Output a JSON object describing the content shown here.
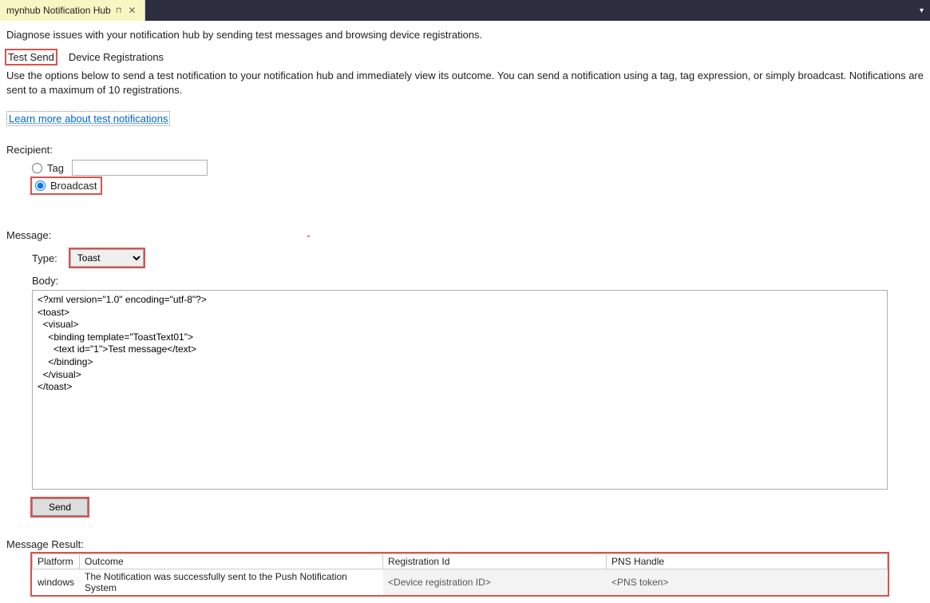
{
  "tab": {
    "title": "mynhub Notification Hub"
  },
  "intro": "Diagnose issues with your notification hub by sending test messages and browsing device registrations.",
  "subtabs": {
    "test_send": "Test Send",
    "device_reg": "Device Registrations"
  },
  "help_text": "Use the options below to send a test notification to your notification hub and immediately view its outcome. You can send a notification using a tag, tag expression, or simply broadcast. Notifications are sent to a maximum of 10 registrations.",
  "learn_more": "Learn more about test notifications",
  "recipient": {
    "label": "Recipient:",
    "tag_label": "Tag",
    "tag_value": "",
    "broadcast_label": "Broadcast",
    "selected": "broadcast"
  },
  "message": {
    "label": "Message:",
    "type_label": "Type:",
    "type_value": "Toast",
    "body_label": "Body:",
    "body_value": "<?xml version=\"1.0\" encoding=\"utf-8\"?>\n<toast>\n  <visual>\n    <binding template=\"ToastText01\">\n      <text id=\"1\">Test message</text>\n    </binding>\n  </visual>\n</toast>"
  },
  "send_label": "Send",
  "result": {
    "label": "Message Result:",
    "columns": {
      "platform": "Platform",
      "outcome": "Outcome",
      "reg_id": "Registration Id",
      "pns": "PNS Handle"
    },
    "row": {
      "platform": "windows",
      "outcome": "The Notification was successfully sent to the Push Notification System",
      "reg_id": "<Device registration ID>",
      "pns": "<PNS token>"
    }
  }
}
